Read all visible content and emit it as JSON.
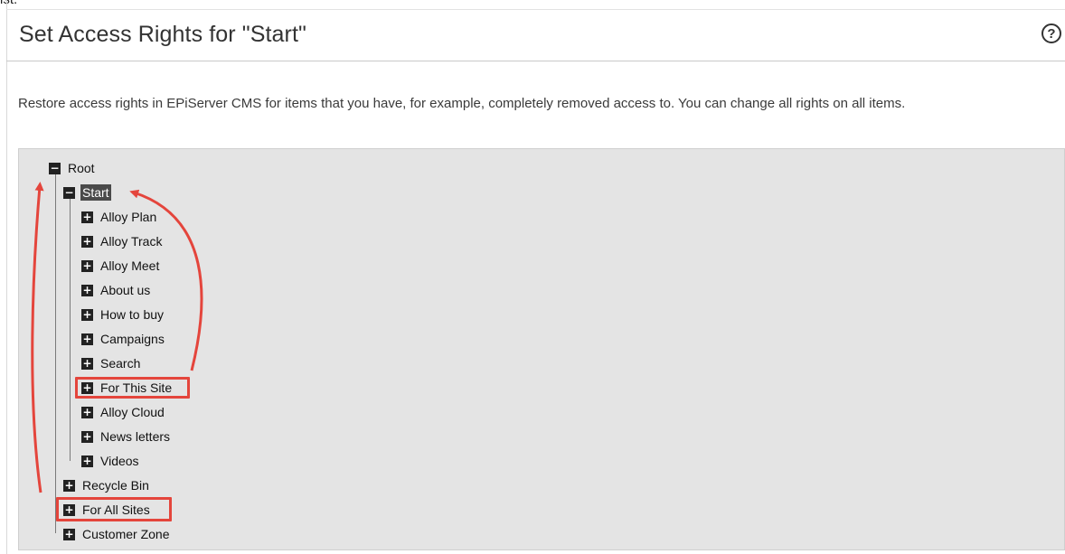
{
  "top_fragment": "ist.",
  "page": {
    "title": "Set Access Rights for \"Start\"",
    "help_icon_glyph": "?",
    "description": "Restore access rights in EPiServer CMS for items that you have, for example, completely removed access to. You can change all rights on all items."
  },
  "tree": {
    "collapse_glyph": "−",
    "expand_glyph": "+",
    "root": "Root",
    "start": "Start",
    "children": [
      "Alloy Plan",
      "Alloy Track",
      "Alloy Meet",
      "About us",
      "How to buy",
      "Campaigns",
      "Search",
      "For This Site",
      "Alloy Cloud",
      "News letters",
      "Videos"
    ],
    "siblings": [
      "Recycle Bin",
      "For All Sites",
      "Customer Zone"
    ]
  },
  "annotation": {
    "color": "#e4453c",
    "highlighted_items": [
      "For This Site",
      "For All Sites"
    ]
  }
}
